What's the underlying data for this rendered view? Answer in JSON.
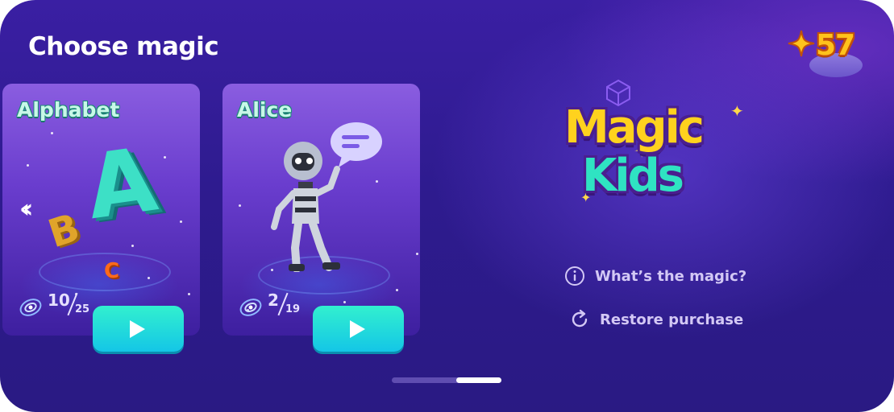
{
  "header": {
    "title": "Choose magic"
  },
  "coins": {
    "count": "57",
    "icon": "sparkle-star-icon",
    "color": "#ffc21c"
  },
  "back": {
    "glyph": "‹‹",
    "icon": "double-chevron-left-icon"
  },
  "cards": [
    {
      "name": "Alphabet",
      "progress_current": "10",
      "progress_total": "25",
      "play_icon": "play-icon",
      "art_letters": [
        "A",
        "B",
        "C"
      ]
    },
    {
      "name": "Alice",
      "progress_current": "2",
      "progress_total": "19",
      "play_icon": "play-icon",
      "art": "robot-with-speech-bubble"
    }
  ],
  "logo": {
    "line1": "Magic",
    "line2": "Kids"
  },
  "links": [
    {
      "label": "What’s the magic?",
      "icon": "info-icon"
    },
    {
      "label": "Restore purchase",
      "icon": "refresh-icon"
    }
  ],
  "pager": {
    "pages": 2,
    "active_index": 1
  },
  "colors": {
    "accent": "#14c6e6",
    "background": "#2e1b8f",
    "card": "#6a3dce",
    "coin": "#ffc21c"
  }
}
